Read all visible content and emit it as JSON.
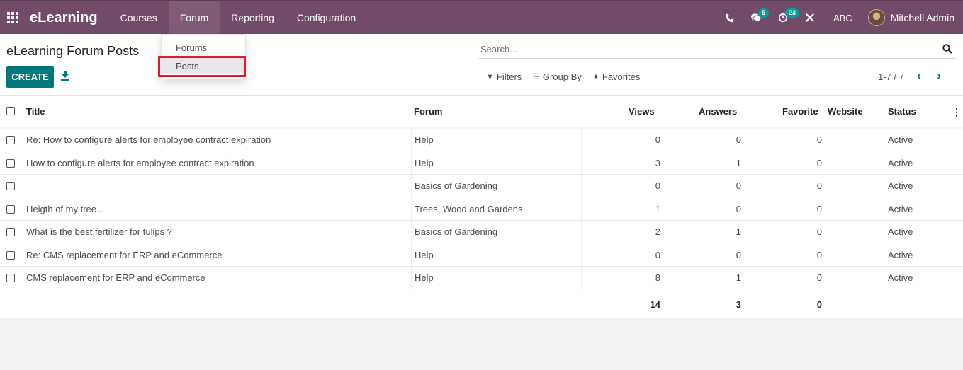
{
  "navbar": {
    "app_name": "eLearning",
    "menu": [
      {
        "label": "Courses",
        "active": false
      },
      {
        "label": "Forum",
        "active": true
      },
      {
        "label": "Reporting",
        "active": false
      },
      {
        "label": "Configuration",
        "active": false
      }
    ],
    "messages_badge": "5",
    "activities_badge": "23",
    "company": "ABC",
    "user_name": "Mitchell Admin"
  },
  "dropdown": {
    "items": [
      {
        "label": "Forums",
        "active": false
      },
      {
        "label": "Posts",
        "active": true
      }
    ]
  },
  "control": {
    "breadcrumb": "eLearning Forum Posts",
    "create_label": "CREATE",
    "search_placeholder": "Search...",
    "filters_label": "Filters",
    "group_by_label": "Group By",
    "favorites_label": "Favorites",
    "pager": "1-7 / 7"
  },
  "table": {
    "headers": {
      "title": "Title",
      "forum": "Forum",
      "views": "Views",
      "answers": "Answers",
      "favorite": "Favorite",
      "website": "Website",
      "status": "Status"
    },
    "rows": [
      {
        "title": "Re: How to configure alerts for employee contract expiration",
        "forum": "Help",
        "views": "0",
        "answers": "0",
        "favorite": "0",
        "website": "",
        "status": "Active"
      },
      {
        "title": "How to configure alerts for employee contract expiration",
        "forum": "Help",
        "views": "3",
        "answers": "1",
        "favorite": "0",
        "website": "",
        "status": "Active"
      },
      {
        "title": "",
        "forum": "Basics of Gardening",
        "views": "0",
        "answers": "0",
        "favorite": "0",
        "website": "",
        "status": "Active"
      },
      {
        "title": "Heigth of my tree...",
        "forum": "Trees, Wood and Gardens",
        "views": "1",
        "answers": "0",
        "favorite": "0",
        "website": "",
        "status": "Active"
      },
      {
        "title": "What is the best fertilizer for tulips ?",
        "forum": "Basics of Gardening",
        "views": "2",
        "answers": "1",
        "favorite": "0",
        "website": "",
        "status": "Active"
      },
      {
        "title": "Re: CMS replacement for ERP and eCommerce",
        "forum": "Help",
        "views": "0",
        "answers": "0",
        "favorite": "0",
        "website": "",
        "status": "Active"
      },
      {
        "title": "CMS replacement for ERP and eCommerce",
        "forum": "Help",
        "views": "8",
        "answers": "1",
        "favorite": "0",
        "website": "",
        "status": "Active"
      }
    ],
    "totals": {
      "views": "14",
      "answers": "3",
      "favorite": "0"
    }
  },
  "colors": {
    "navbar": "#714b67",
    "primary_button": "#00777a",
    "badge": "#00a09d",
    "highlight": "#e21a26"
  }
}
